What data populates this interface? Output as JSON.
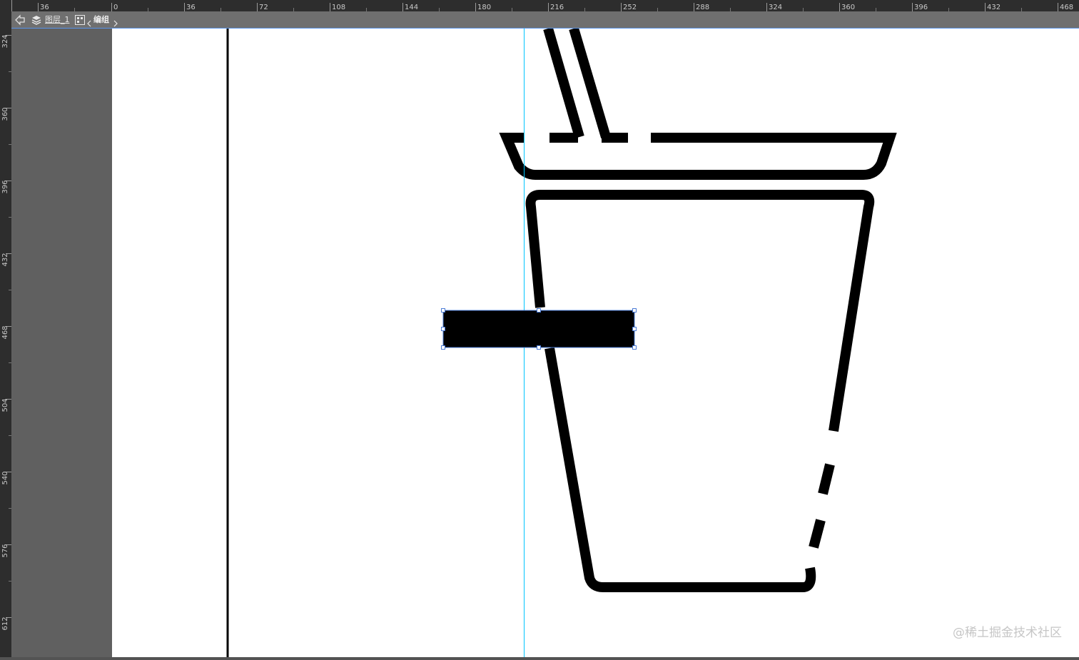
{
  "ruler": {
    "horizontal_labels": [
      "36",
      "0",
      "36",
      "72",
      "108",
      "144",
      "180",
      "216",
      "252",
      "288",
      "324",
      "360",
      "396",
      "432",
      "468"
    ],
    "vertical_labels": [
      "324",
      "360",
      "396",
      "432",
      "468",
      "504",
      "540",
      "576",
      "612"
    ]
  },
  "breadcrumb": {
    "layer": "图层_1",
    "group": "编组"
  },
  "watermark": "@稀土掘金技术社区",
  "colors": {
    "guide": "#00c5ff",
    "selection": "#4a7bd6",
    "artwork": "#000000"
  },
  "icons": {
    "back": "back-arrow-icon",
    "layers": "layers-icon",
    "group": "group-icon"
  }
}
